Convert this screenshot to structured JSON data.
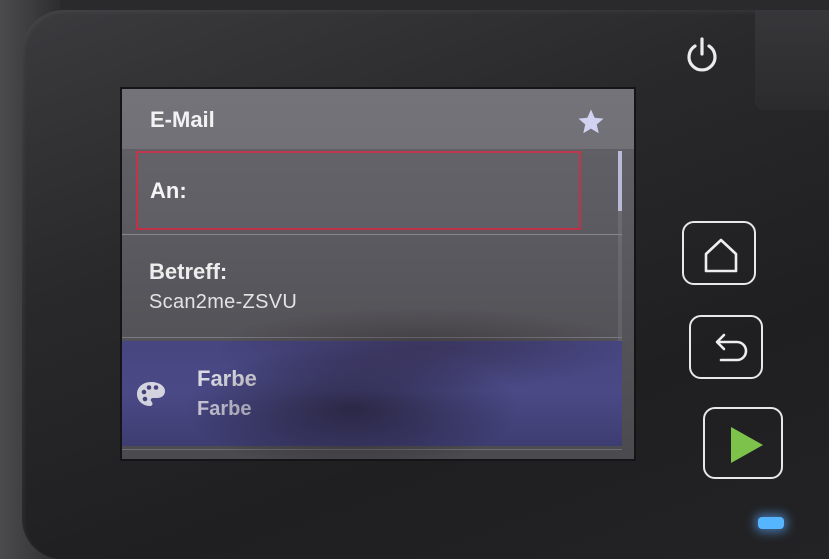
{
  "screen": {
    "header": {
      "title": "E-Mail",
      "favorite_icon": "star-icon"
    },
    "fields": {
      "to_label": "An:",
      "subject_label": "Betreff:",
      "subject_value": "Scan2me-ZSVU"
    },
    "color_setting": {
      "icon": "palette-icon",
      "title": "Farbe",
      "value": "Farbe"
    }
  },
  "hardware_buttons": [
    "power-icon",
    "home-icon",
    "back-icon",
    "start-icon"
  ],
  "colors": {
    "selected_row": "#51508f",
    "focus_border": "#c03045",
    "start_icon": "#7dc24b",
    "led": "#55b6ff"
  }
}
